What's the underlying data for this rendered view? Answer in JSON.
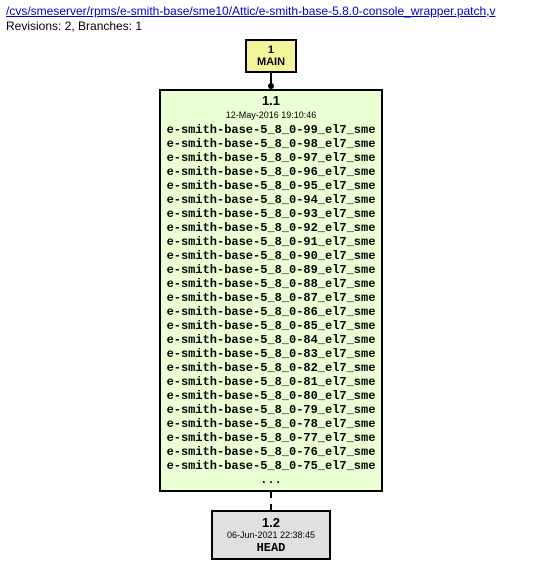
{
  "header": {
    "path": "/cvs/smeserver/rpms/e-smith-base/sme10/Attic/e-smith-base-5.8.0-console_wrapper.patch,v",
    "meta": "Revisions: 2, Branches: 1"
  },
  "main_node": {
    "number": "1",
    "label": "MAIN"
  },
  "rev1": {
    "number": "1.1",
    "date": "12-May-2016 19:10:46",
    "tags": [
      "e-smith-base-5_8_0-99_el7_sme",
      "e-smith-base-5_8_0-98_el7_sme",
      "e-smith-base-5_8_0-97_el7_sme",
      "e-smith-base-5_8_0-96_el7_sme",
      "e-smith-base-5_8_0-95_el7_sme",
      "e-smith-base-5_8_0-94_el7_sme",
      "e-smith-base-5_8_0-93_el7_sme",
      "e-smith-base-5_8_0-92_el7_sme",
      "e-smith-base-5_8_0-91_el7_sme",
      "e-smith-base-5_8_0-90_el7_sme",
      "e-smith-base-5_8_0-89_el7_sme",
      "e-smith-base-5_8_0-88_el7_sme",
      "e-smith-base-5_8_0-87_el7_sme",
      "e-smith-base-5_8_0-86_el7_sme",
      "e-smith-base-5_8_0-85_el7_sme",
      "e-smith-base-5_8_0-84_el7_sme",
      "e-smith-base-5_8_0-83_el7_sme",
      "e-smith-base-5_8_0-82_el7_sme",
      "e-smith-base-5_8_0-81_el7_sme",
      "e-smith-base-5_8_0-80_el7_sme",
      "e-smith-base-5_8_0-79_el7_sme",
      "e-smith-base-5_8_0-78_el7_sme",
      "e-smith-base-5_8_0-77_el7_sme",
      "e-smith-base-5_8_0-76_el7_sme",
      "e-smith-base-5_8_0-75_el7_sme"
    ],
    "ellipsis": "..."
  },
  "rev2": {
    "number": "1.2",
    "date": "06-Jun-2021 22:38:45",
    "label": "HEAD"
  }
}
